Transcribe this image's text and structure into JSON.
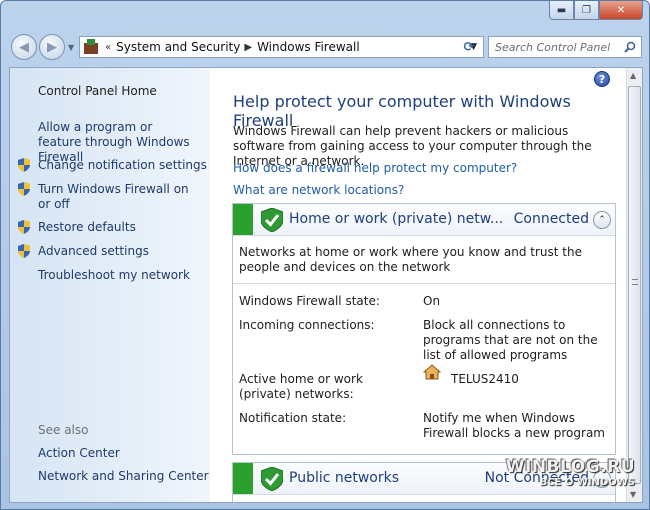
{
  "window": {
    "minimize": "▬",
    "maximize": "❐",
    "close": "✕"
  },
  "nav": {
    "back": "◀",
    "forward": "▶",
    "dropdown": "▼",
    "breadcrumb_sep": "«",
    "crumbs": [
      "System and Security",
      "Windows Firewall"
    ],
    "crumb_arrow": "▶",
    "refresh": "⟳",
    "search_placeholder": "Search Control Panel"
  },
  "sidebar": {
    "home": "Control Panel Home",
    "links": [
      {
        "label": "Allow a program or feature through Windows Firewall",
        "shield": false
      },
      {
        "label": "Change notification settings",
        "shield": true
      },
      {
        "label": "Turn Windows Firewall on or off",
        "shield": true
      },
      {
        "label": "Restore defaults",
        "shield": true
      },
      {
        "label": "Advanced settings",
        "shield": true
      },
      {
        "label": "Troubleshoot my network",
        "shield": false
      }
    ],
    "see_also_label": "See also",
    "see_also": [
      "Action Center",
      "Network and Sharing Center"
    ]
  },
  "main": {
    "help": "?",
    "title": "Help protect your computer with Windows Firewall",
    "description": "Windows Firewall can help prevent hackers or malicious software from gaining access to your computer through the Internet or a network.",
    "link_how": "How does a firewall help protect my computer?",
    "link_locations": "What are network locations?",
    "home_panel": {
      "name": "Home or work (private) netw...",
      "status": "Connected",
      "collapse": "⌃",
      "description": "Networks at home or work where you know and trust the people and devices on the network",
      "rows": [
        {
          "key": "Windows Firewall state:",
          "value": "On"
        },
        {
          "key": "Incoming connections:",
          "value": "Block all connections to programs that are not on the list of allowed programs"
        },
        {
          "key": "Active home or work (private) networks:",
          "value": "TELUS2410"
        },
        {
          "key": "Notification state:",
          "value": "Notify me when Windows Firewall blocks a new program"
        }
      ]
    },
    "public_panel": {
      "name": "Public networks",
      "status": "Not Connected",
      "collapse": "⌄"
    }
  },
  "watermark": {
    "line1": "WINBLOG.RU",
    "line2": "ВСЁ О WINDOWS"
  },
  "colors": {
    "accent_green": "#2aa12e",
    "title_blue": "#1e3f7e",
    "link_blue": "#1f5da4"
  }
}
